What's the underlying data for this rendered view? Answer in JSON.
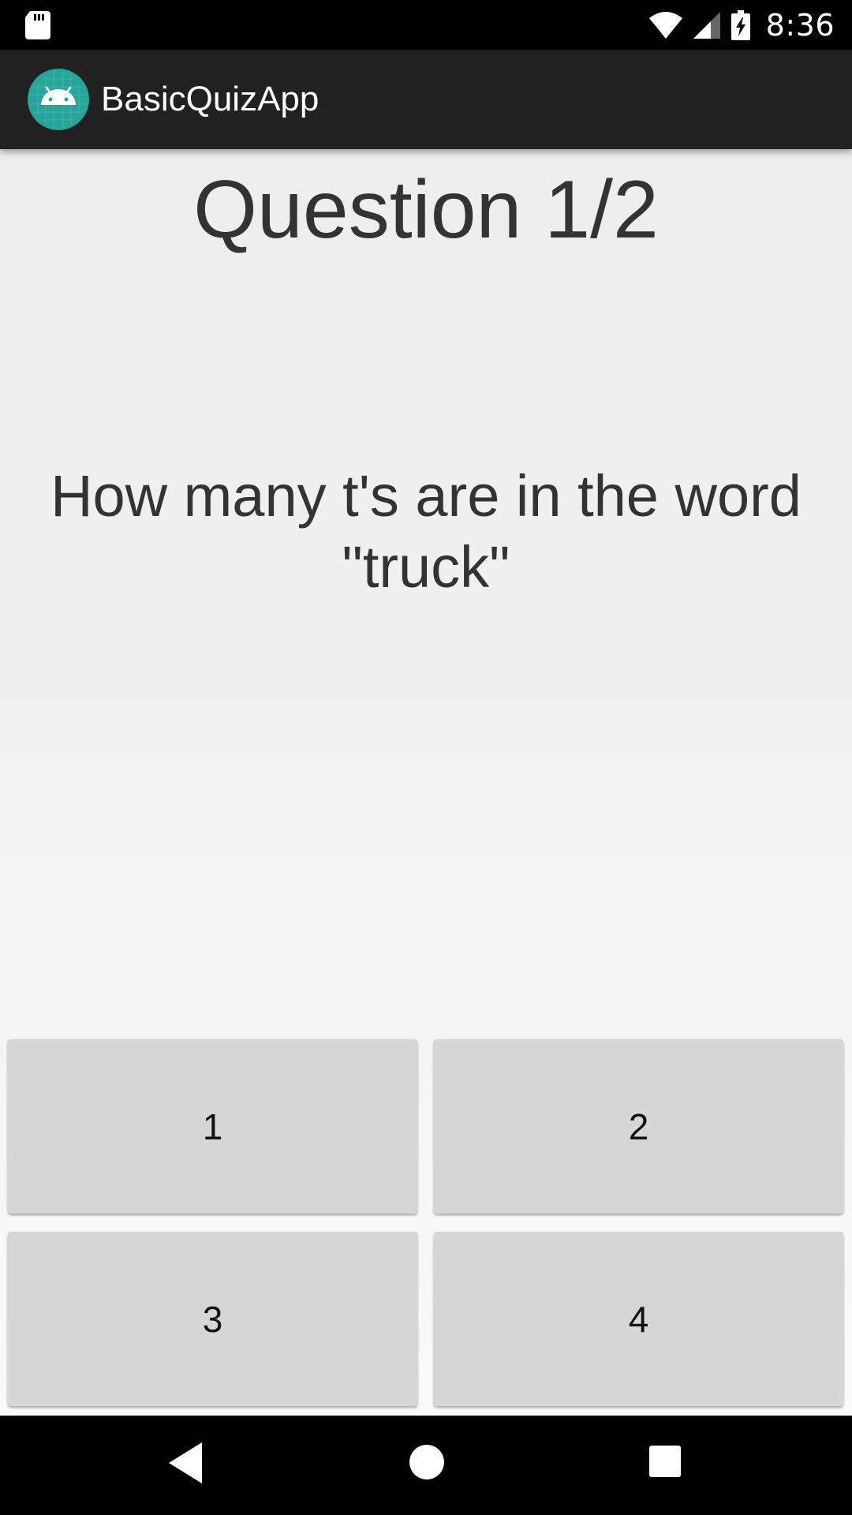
{
  "status_bar": {
    "time": "8:36",
    "icons": [
      "sd-card-icon",
      "wifi-icon",
      "cell-signal-icon",
      "battery-charging-icon"
    ]
  },
  "app_bar": {
    "title": "BasicQuizApp",
    "logo_icon": "android-icon",
    "logo_color": "#26a69a"
  },
  "quiz": {
    "header": "Question 1/2",
    "question": "How many t's are in the word \"truck\"",
    "answers": [
      "1",
      "2",
      "3",
      "4"
    ]
  },
  "nav_bar": {
    "icons": [
      "back-icon",
      "home-icon",
      "recents-icon"
    ]
  },
  "colors": {
    "status_bar": "#000000",
    "app_bar": "#212121",
    "button": "#d6d6d6",
    "text": "#333333"
  }
}
